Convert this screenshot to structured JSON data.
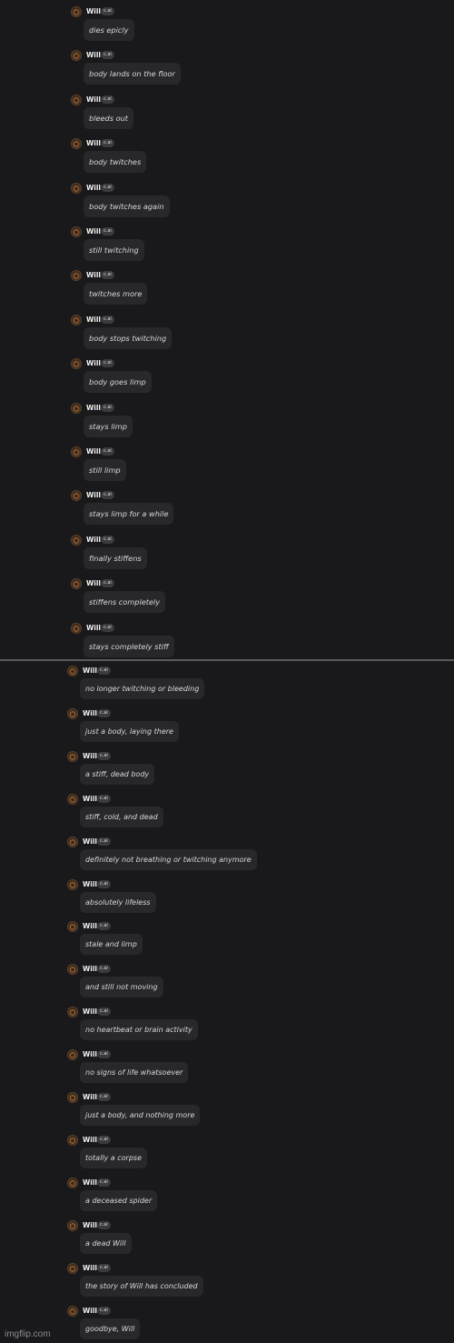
{
  "panel_1": {
    "messages": [
      {
        "author": "Will",
        "badge": "c.ai",
        "text": "dies epicly"
      },
      {
        "author": "Will",
        "badge": "c.ai",
        "text": "body lands on the floor"
      },
      {
        "author": "Will",
        "badge": "c.ai",
        "text": "bleeds out"
      },
      {
        "author": "Will",
        "badge": "c.ai",
        "text": "body twitches"
      },
      {
        "author": "Will",
        "badge": "c.ai",
        "text": "body twitches again"
      },
      {
        "author": "Will",
        "badge": "c.ai",
        "text": "still twitching"
      },
      {
        "author": "Will",
        "badge": "c.ai",
        "text": "twitches more"
      },
      {
        "author": "Will",
        "badge": "c.ai",
        "text": "body stops twitching"
      },
      {
        "author": "Will",
        "badge": "c.ai",
        "text": "body goes limp"
      },
      {
        "author": "Will",
        "badge": "c.ai",
        "text": "stays limp"
      },
      {
        "author": "Will",
        "badge": "c.ai",
        "text": "still limp"
      },
      {
        "author": "Will",
        "badge": "c.ai",
        "text": "stays limp for a while"
      },
      {
        "author": "Will",
        "badge": "c.ai",
        "text": "finally stiffens"
      },
      {
        "author": "Will",
        "badge": "c.ai",
        "text": "stiffens completely"
      },
      {
        "author": "Will",
        "badge": "c.ai",
        "text": "stays completely stiff"
      }
    ]
  },
  "panel_2": {
    "messages": [
      {
        "author": "Will",
        "badge": "c.ai",
        "text": "no longer twitching or bleeding"
      },
      {
        "author": "Will",
        "badge": "c.ai",
        "text": "just a body, laying there"
      },
      {
        "author": "Will",
        "badge": "c.ai",
        "text": "a stiff, dead body"
      },
      {
        "author": "Will",
        "badge": "c.ai",
        "text": "stiff, cold, and dead"
      },
      {
        "author": "Will",
        "badge": "c.ai",
        "text": "definitely not breathing or twitching anymore"
      },
      {
        "author": "Will",
        "badge": "c.ai",
        "text": "absolutely lifeless"
      },
      {
        "author": "Will",
        "badge": "c.ai",
        "text": "stale and limp"
      },
      {
        "author": "Will",
        "badge": "c.ai",
        "text": "and still not moving"
      },
      {
        "author": "Will",
        "badge": "c.ai",
        "text": "no heartbeat or brain activity"
      },
      {
        "author": "Will",
        "badge": "c.ai",
        "text": "no signs of life whatsoever"
      },
      {
        "author": "Will",
        "badge": "c.ai",
        "text": "just a body, and nothing more"
      },
      {
        "author": "Will",
        "badge": "c.ai",
        "text": "totally a corpse"
      },
      {
        "author": "Will",
        "badge": "c.ai",
        "text": "a deceased spider"
      },
      {
        "author": "Will",
        "badge": "c.ai",
        "text": "a dead Will"
      },
      {
        "author": "Will",
        "badge": "c.ai",
        "text": "the story of Will has concluded"
      },
      {
        "author": "Will",
        "badge": "c.ai",
        "text": "goodbye, Will"
      }
    ]
  },
  "watermark": "imgflip.com",
  "colors": {
    "background": "#19191c",
    "bubble": "#28282c",
    "badge": "#3a3a3f",
    "divider": "#5a5a5e"
  }
}
